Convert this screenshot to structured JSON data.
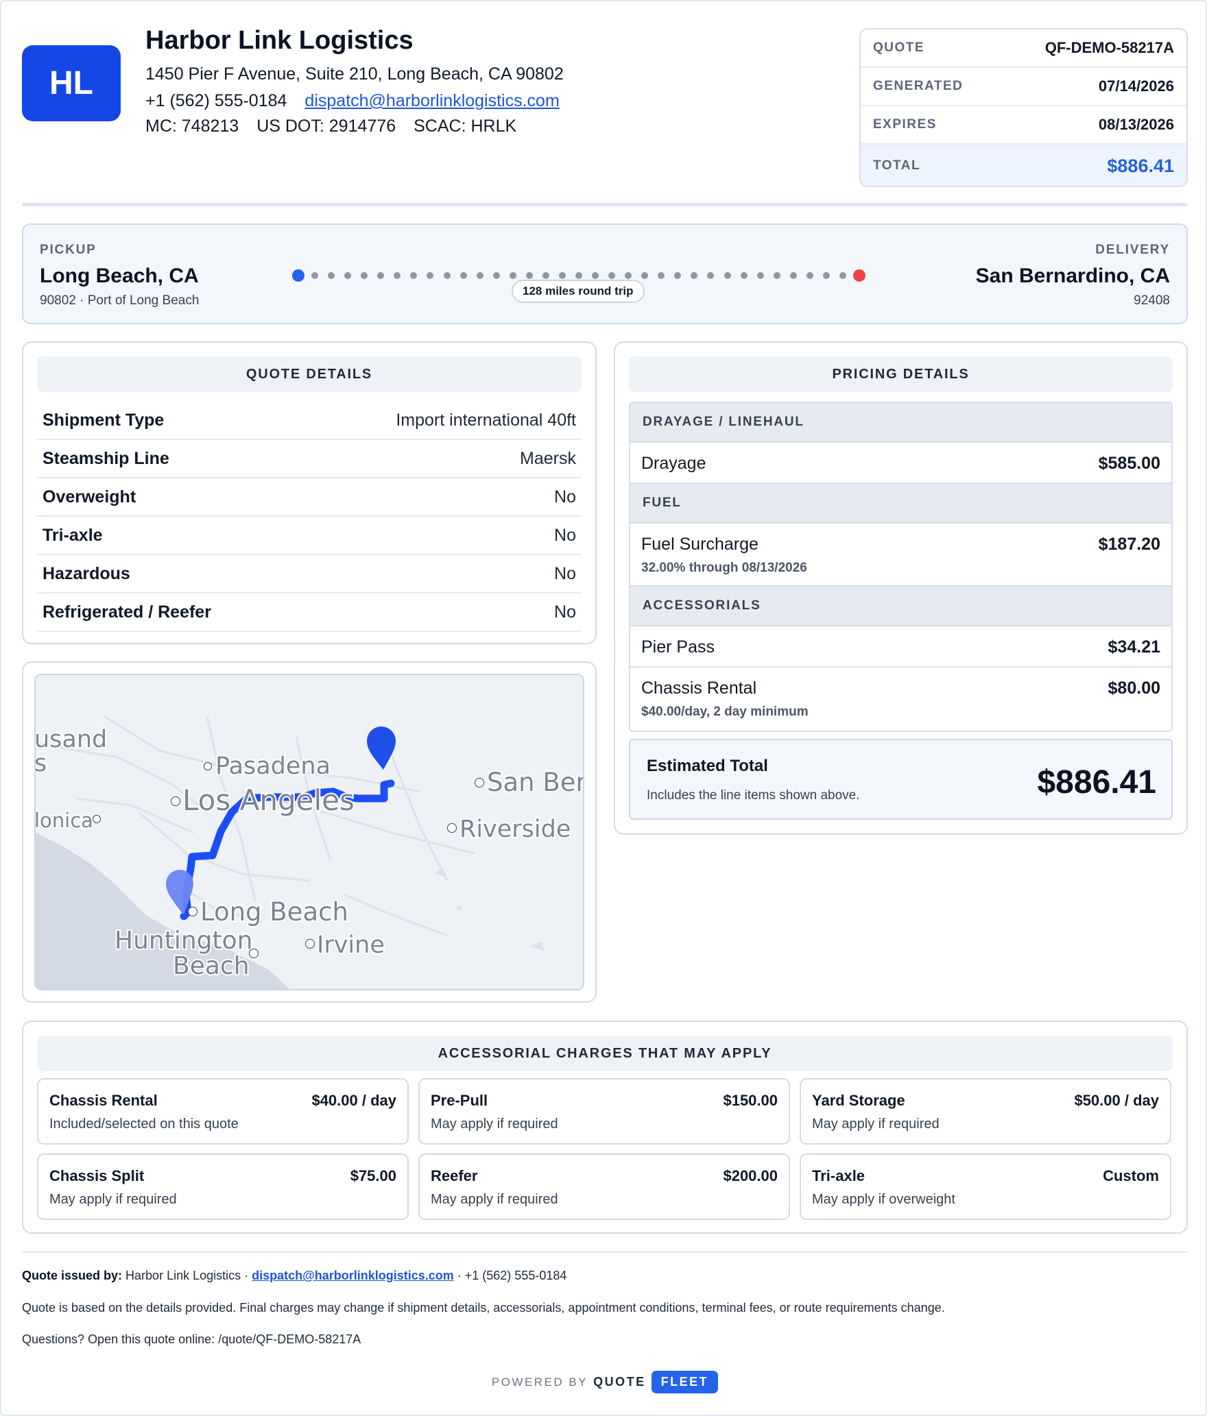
{
  "company": {
    "logo_initials": "HL",
    "name": "Harbor Link Logistics",
    "address": "1450 Pier F Avenue, Suite 210, Long Beach, CA 90802",
    "phone": "+1 (562) 555-0184",
    "email": "dispatch@harborlinklogistics.com",
    "mc": "MC: 748213",
    "dot": "US DOT: 2914776",
    "scac": "SCAC: HRLK",
    "brand_color": "#1447e6"
  },
  "quote_box": {
    "rows": [
      {
        "label": "QUOTE",
        "value": "QF-DEMO-58217A"
      },
      {
        "label": "GENERATED",
        "value": "07/14/2026"
      },
      {
        "label": "EXPIRES",
        "value": "08/13/2026"
      },
      {
        "label": "TOTAL",
        "value": "$886.41"
      }
    ]
  },
  "route": {
    "pickup_label": "PICKUP",
    "pickup_city": "Long Beach, CA",
    "pickup_sub": "90802 · Port of Long Beach",
    "delivery_label": "DELIVERY",
    "delivery_city": "San Bernardino, CA",
    "delivery_sub": "92408",
    "miles": "128 miles round trip",
    "start_color": "#2563eb",
    "end_color": "#ef4444"
  },
  "quote_details": {
    "title": "QUOTE DETAILS",
    "rows": [
      {
        "label": "Shipment Type",
        "value": "Import international 40ft"
      },
      {
        "label": "Steamship Line",
        "value": "Maersk"
      },
      {
        "label": "Overweight",
        "value": "No"
      },
      {
        "label": "Tri-axle",
        "value": "No"
      },
      {
        "label": "Hazardous",
        "value": "No"
      },
      {
        "label": "Refrigerated / Reefer",
        "value": "No"
      }
    ]
  },
  "map": {
    "labels": {
      "pasadena": "Pasadena",
      "los_angeles": "Los Angeles",
      "san_bern": "San Berr",
      "riverside": "Riverside",
      "long_beach": "Long Beach",
      "huntington": "Huntington",
      "beach": "Beach",
      "irvine": "Irvine",
      "usand": "usand",
      "s": "s",
      "lonica": "lonica"
    },
    "route_color": "#1d4ef5"
  },
  "pricing": {
    "title": "PRICING DETAILS",
    "sections": {
      "drayage": "DRAYAGE / LINEHAUL",
      "fuel": "FUEL",
      "accessorials": "ACCESSORIALS"
    },
    "items": {
      "drayage": {
        "name": "Drayage",
        "amount": "$585.00"
      },
      "fuel": {
        "name": "Fuel Surcharge",
        "amount": "$187.20",
        "note": "32.00% through 08/13/2026"
      },
      "pier_pass": {
        "name": "Pier Pass",
        "amount": "$34.21"
      },
      "chassis": {
        "name": "Chassis Rental",
        "amount": "$80.00",
        "note": "$40.00/day, 2 day minimum"
      }
    },
    "estimated_total_label": "Estimated Total",
    "estimated_total_note": "Includes the line items shown above.",
    "estimated_total": "$886.41"
  },
  "accessorials": {
    "title": "ACCESSORIAL CHARGES THAT MAY APPLY",
    "items": [
      {
        "name": "Chassis Rental",
        "price": "$40.00 / day",
        "note": "Included/selected on this quote"
      },
      {
        "name": "Pre-Pull",
        "price": "$150.00",
        "note": "May apply if required"
      },
      {
        "name": "Yard Storage",
        "price": "$50.00 / day",
        "note": "May apply if required"
      },
      {
        "name": "Chassis Split",
        "price": "$75.00",
        "note": "May apply if required"
      },
      {
        "name": "Reefer",
        "price": "$200.00",
        "note": "May apply if required"
      },
      {
        "name": "Tri-axle",
        "price": "Custom",
        "note": "May apply if overweight"
      }
    ]
  },
  "footer": {
    "issued_label": "Quote issued by:",
    "issued_company": "Harbor Link Logistics ·",
    "email": "dispatch@harborlinklogistics.com",
    "phone": "· +1 (562) 555-0184",
    "disclaimer": "Quote is based on the details provided. Final charges may change if shipment details, accessorials, appointment conditions, terminal fees, or route requirements change.",
    "questions": "Questions? Open this quote online: /quote/QF-DEMO-58217A",
    "powered_by": "POWERED BY",
    "brand_quote": "QUOTE",
    "brand_fleet": "FLEET"
  }
}
